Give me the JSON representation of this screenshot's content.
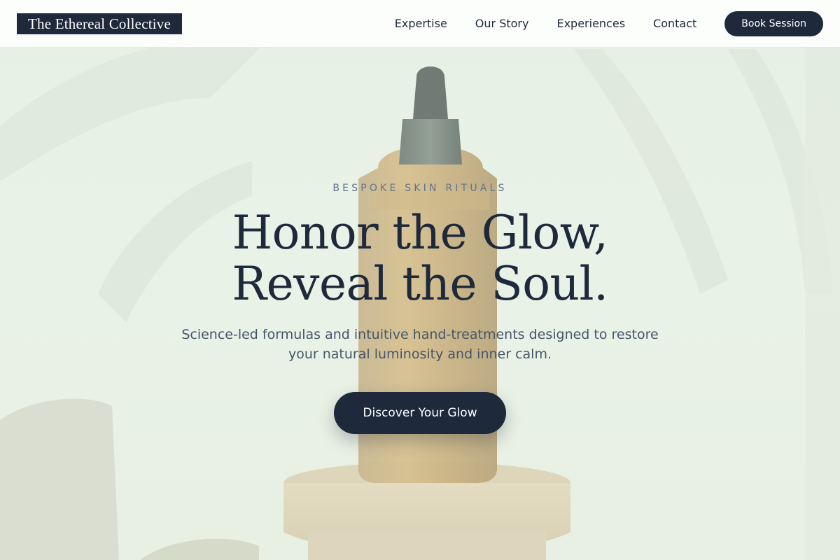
{
  "header": {
    "logo_text": "The Ethereal Collective",
    "nav": [
      {
        "label": "Expertise"
      },
      {
        "label": "Our Story"
      },
      {
        "label": "Experiences"
      },
      {
        "label": "Contact"
      }
    ],
    "cta_label": "Book Session"
  },
  "hero": {
    "eyebrow": "BESPOKE SKIN RITUALS",
    "headline_line1": "Honor the Glow,",
    "headline_line2": "Reveal the Soul.",
    "subtext": "Science-led formulas and intuitive hand-treatments designed to restore your natural luminosity and inner calm.",
    "cta_label": "Discover Your Glow"
  },
  "colors": {
    "primary": "#1e293b",
    "text_muted": "#64748b",
    "text_body": "#475569",
    "hero_bg": "#e8f0e6",
    "header_bg": "#ffffff"
  }
}
